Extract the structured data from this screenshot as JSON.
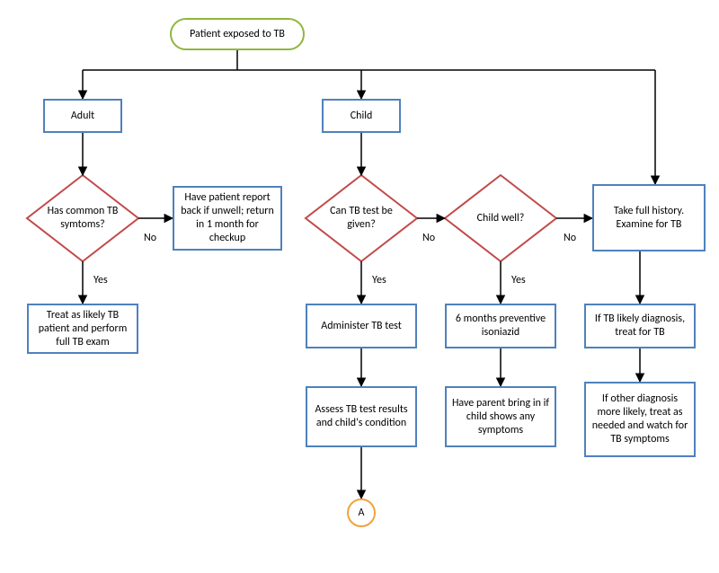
{
  "chart_data": {
    "type": "flowchart",
    "nodes": [
      {
        "id": "start",
        "shape": "terminator",
        "label": "Patient exposed to TB"
      },
      {
        "id": "adult",
        "shape": "process",
        "label": "Adult"
      },
      {
        "id": "child",
        "shape": "process",
        "label": "Child"
      },
      {
        "id": "d_adult_sym",
        "shape": "decision",
        "label": "Has common TB symtoms?"
      },
      {
        "id": "adult_no",
        "shape": "process",
        "label": "Have patient report back if unwell; return in 1 month for checkup"
      },
      {
        "id": "adult_yes",
        "shape": "process",
        "label": "Treat as likely TB patient and perform full TB exam"
      },
      {
        "id": "d_can_test",
        "shape": "decision",
        "label": "Can TB test be given?"
      },
      {
        "id": "admin_test",
        "shape": "process",
        "label": "Administer TB test"
      },
      {
        "id": "assess",
        "shape": "process",
        "label": "Assess TB test results and child's condition"
      },
      {
        "id": "conn_a",
        "shape": "connector",
        "label": "A"
      },
      {
        "id": "d_child_well",
        "shape": "decision",
        "label": "Child well?"
      },
      {
        "id": "iso",
        "shape": "process",
        "label": "6 months preventive isoniazid"
      },
      {
        "id": "bringin",
        "shape": "process",
        "label": "Have parent bring in if child shows any symptoms"
      },
      {
        "id": "hist",
        "shape": "process",
        "label": "Take full history. Examine for TB"
      },
      {
        "id": "treat_tb",
        "shape": "process",
        "label": "If TB likely diagnosis, treat for TB"
      },
      {
        "id": "other_dx",
        "shape": "process",
        "label": "If other diagnosis more likely, treat as needed and watch for TB symptoms"
      }
    ],
    "edges": [
      {
        "from": "start",
        "to": "adult"
      },
      {
        "from": "start",
        "to": "child"
      },
      {
        "from": "adult",
        "to": "d_adult_sym"
      },
      {
        "from": "d_adult_sym",
        "to": "adult_no",
        "label": "No"
      },
      {
        "from": "d_adult_sym",
        "to": "adult_yes",
        "label": "Yes"
      },
      {
        "from": "child",
        "to": "d_can_test"
      },
      {
        "from": "d_can_test",
        "to": "admin_test",
        "label": "Yes"
      },
      {
        "from": "admin_test",
        "to": "assess"
      },
      {
        "from": "assess",
        "to": "conn_a"
      },
      {
        "from": "d_can_test",
        "to": "d_child_well",
        "label": "No"
      },
      {
        "from": "d_child_well",
        "to": "iso",
        "label": "Yes"
      },
      {
        "from": "iso",
        "to": "bringin"
      },
      {
        "from": "d_child_well",
        "to": "hist",
        "label": "No"
      },
      {
        "from": "hist",
        "to": "treat_tb"
      },
      {
        "from": "treat_tb",
        "to": "other_dx"
      }
    ]
  },
  "labels": {
    "yes": "Yes",
    "no": "No"
  }
}
